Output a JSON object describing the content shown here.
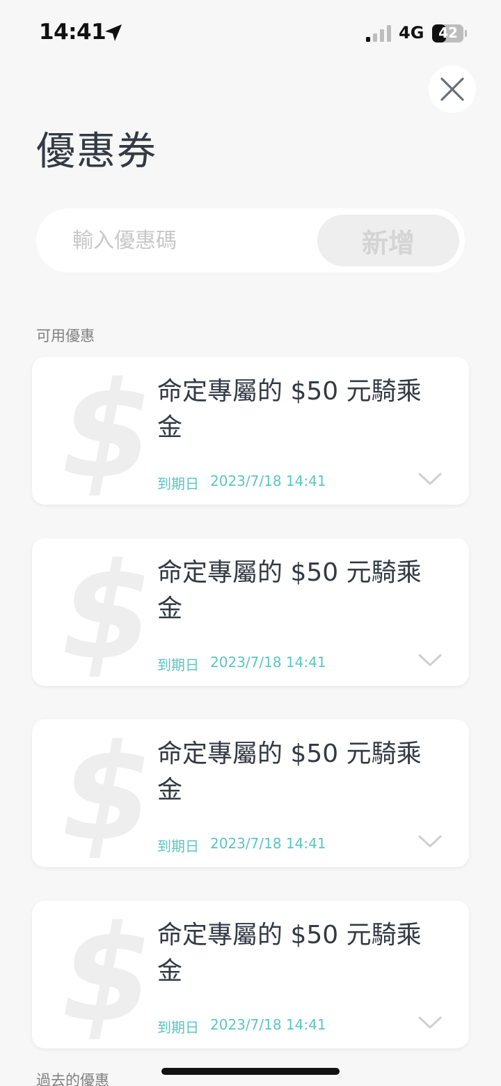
{
  "status_bar": {
    "time": "14:41",
    "network": "4G",
    "battery": "42"
  },
  "page": {
    "title": "優惠券"
  },
  "promo": {
    "placeholder": "輸入優惠碼",
    "add_label": "新增"
  },
  "sections": {
    "available": "可用優惠",
    "past": "過去的優惠"
  },
  "coupons": [
    {
      "title": "命定專屬的 $50 元騎乘金",
      "expiry_label": "到期日",
      "expiry_date": "2023/7/18 14:41",
      "icon": "dollar-icon"
    },
    {
      "title": "命定專屬的 $50 元騎乘金",
      "expiry_label": "到期日",
      "expiry_date": "2023/7/18 14:41",
      "icon": "dollar-icon"
    },
    {
      "title": "命定專屬的 $50 元騎乘金",
      "expiry_label": "到期日",
      "expiry_date": "2023/7/18 14:41",
      "icon": "dollar-icon"
    },
    {
      "title": "命定專屬的 $50 元騎乘金",
      "expiry_label": "到期日",
      "expiry_date": "2023/7/18 14:41",
      "icon": "dollar-icon"
    }
  ],
  "colors": {
    "accent": "#5bc4c4",
    "title_text": "#333a44",
    "background": "#f7f7f7"
  }
}
